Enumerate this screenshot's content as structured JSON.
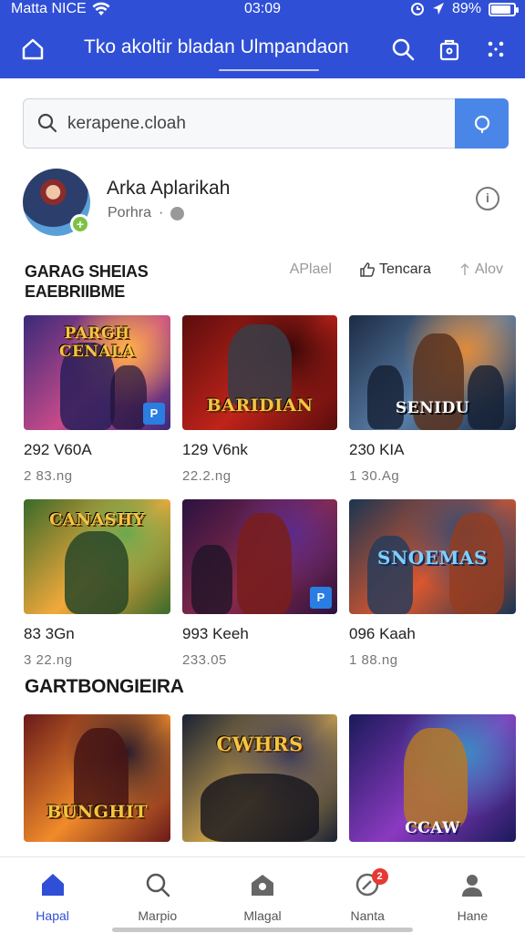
{
  "status_bar": {
    "carrier": "Matta NICE",
    "time": "03:09",
    "battery": "89%",
    "battery_level": 0.89
  },
  "header": {
    "title": "Tko akoltir bladan Ulmpandaon",
    "icons": [
      "home-icon",
      "search-icon",
      "bag-icon",
      "more-icon"
    ]
  },
  "search": {
    "placeholder": "kerapene.cloah",
    "button_icon": "search-icon"
  },
  "profile": {
    "name": "Arka Aplarikah",
    "subtitle": "Porhra",
    "separator": "·"
  },
  "section1": {
    "title_line1": "GARAG SHEIAS",
    "title_line2": "EAEBRIIBME",
    "tabs": [
      {
        "label": "APlael"
      },
      {
        "label": "Tencara"
      },
      {
        "label": "Alov"
      }
    ]
  },
  "games_row1": [
    {
      "logo": "PARGH CENALA",
      "name": "292 V60A",
      "sub": "2 83.ng",
      "badge": "P",
      "colors": [
        "#3a2a7a",
        "#c84a8a",
        "#ffb347"
      ]
    },
    {
      "logo": "BARIDIAN",
      "name": "129 V6nk",
      "sub": "22.2.ng",
      "badge": "",
      "colors": [
        "#5a0d0d",
        "#c0231a",
        "#3a0808"
      ]
    },
    {
      "logo": "SENIDU",
      "name": "230 KIA",
      "sub": "1 30.Ag",
      "badge": "",
      "colors": [
        "#1c2b44",
        "#5a7fa8",
        "#e08a3a"
      ]
    }
  ],
  "games_row2": [
    {
      "logo": "CANASHY",
      "name": "83 3Gn",
      "sub": "3 22.ng",
      "badge": "",
      "colors": [
        "#3a6a2a",
        "#f2a93b",
        "#6aa84f"
      ]
    },
    {
      "logo": "",
      "name": "993 Keeh",
      "sub": "233.05",
      "badge": "P",
      "colors": [
        "#2a1240",
        "#8a2a4a",
        "#5a2a8a"
      ]
    },
    {
      "logo": "SNOEMAS",
      "name": "096 Kaah",
      "sub": "1 88.ng",
      "badge": "",
      "colors": [
        "#1a3552",
        "#d9572e",
        "#2a4a78"
      ]
    }
  ],
  "section2": {
    "title": "GARTBONGIEIRA"
  },
  "games_row3": [
    {
      "logo": "BUNGHIT",
      "colors": [
        "#6a1a1a",
        "#f08a2a",
        "#2a1a2a"
      ]
    },
    {
      "logo": "CWHRS",
      "colors": [
        "#1a2235",
        "#c9a04a",
        "#3a3a5a"
      ]
    },
    {
      "logo": "CCAW",
      "colors": [
        "#1a1a5a",
        "#8a3ac0",
        "#3a8ac0"
      ]
    }
  ],
  "bottom_nav": [
    {
      "label": "Hapal",
      "icon": "home-icon",
      "active": true
    },
    {
      "label": "Marpio",
      "icon": "search-icon",
      "active": false
    },
    {
      "label": "Mlagal",
      "icon": "store-icon",
      "active": false
    },
    {
      "label": "Nanta",
      "icon": "notification-icon",
      "active": false,
      "badge": "2"
    },
    {
      "label": "Hane",
      "icon": "profile-icon",
      "active": false
    }
  ],
  "colors": {
    "brand": "#2f4fd6",
    "search_button": "#4a86e8"
  }
}
